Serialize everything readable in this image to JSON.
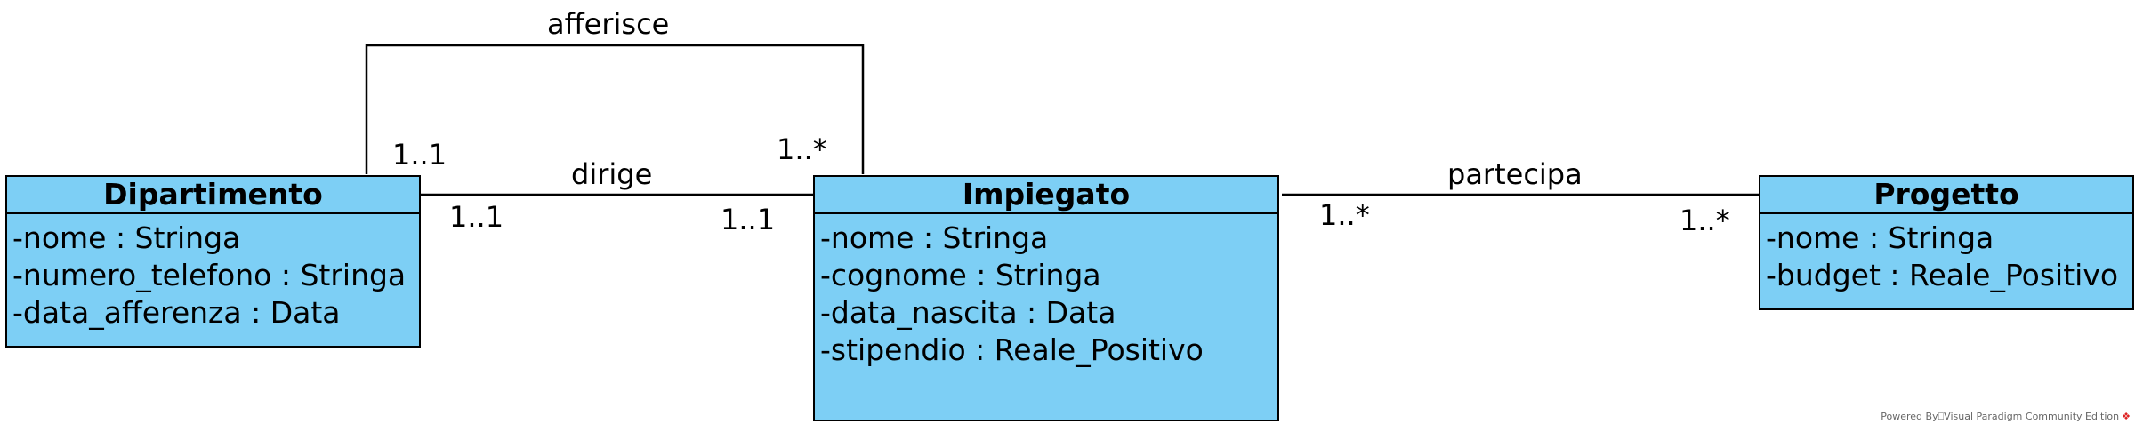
{
  "classes": {
    "dipartimento": {
      "name": "Dipartimento",
      "attributes": [
        "-nome : Stringa",
        "-numero_telefono : Stringa",
        "-data_afferenza : Data"
      ]
    },
    "impiegato": {
      "name": "Impiegato",
      "attributes": [
        "-nome : Stringa",
        "-cognome : Stringa",
        "-data_nascita : Data",
        "-stipendio : Reale_Positivo"
      ]
    },
    "progetto": {
      "name": "Progetto",
      "attributes": [
        "-nome : Stringa",
        "-budget : Reale_Positivo"
      ]
    }
  },
  "associations": {
    "afferisce": {
      "name": "afferisce",
      "mult_dipartimento": "1..1",
      "mult_impiegato": "1..*"
    },
    "dirige": {
      "name": "dirige",
      "mult_dipartimento": "1..1",
      "mult_impiegato": "1..1"
    },
    "partecipa": {
      "name": "partecipa",
      "mult_impiegato": "1..*",
      "mult_progetto": "1..*"
    }
  },
  "footer": {
    "text": "Powered By⎕Visual Paradigm Community Edition",
    "logo_icon": "visual-paradigm-logo-icon"
  }
}
